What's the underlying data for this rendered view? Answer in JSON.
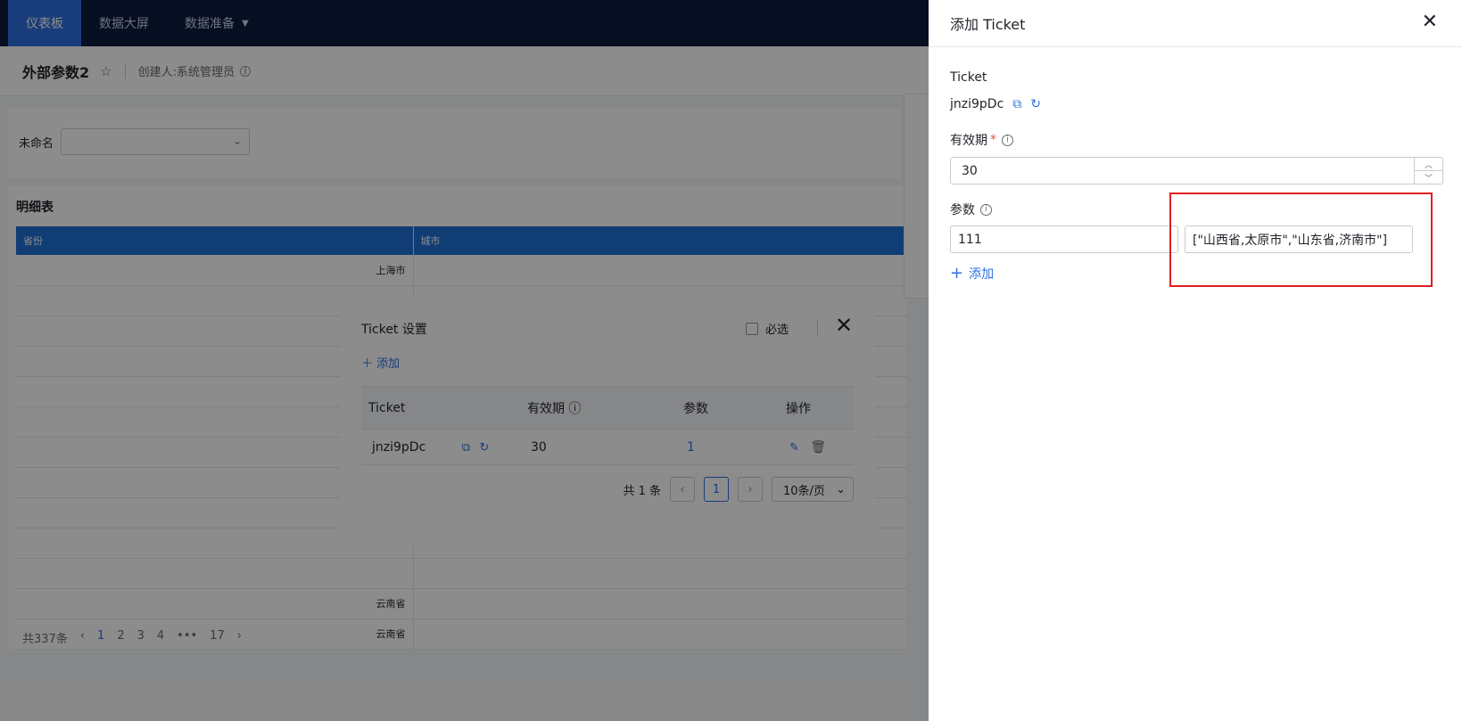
{
  "nav": {
    "items": [
      "仪表板",
      "数据大屏",
      "数据准备"
    ]
  },
  "subheader": {
    "title": "外部参数2",
    "creator": "创建人:系统管理员"
  },
  "filter": {
    "label": "未命名",
    "value": ""
  },
  "detail_table": {
    "title": "明细表",
    "columns": [
      "省份",
      "城市"
    ],
    "rows": [
      "上海市",
      "",
      "",
      "",
      "",
      "",
      "",
      "",
      "",
      "",
      "",
      "云南省",
      "云南省"
    ],
    "total": "共337条",
    "pages": [
      "1",
      "2",
      "3",
      "4",
      "•••",
      "17"
    ]
  },
  "ticket_dialog": {
    "title": "Ticket 设置",
    "required_label": "必选",
    "add_label": "添加",
    "columns": [
      "Ticket",
      "有效期",
      "参数",
      "操作"
    ],
    "rows": [
      {
        "ticket": "jnzi9pDc",
        "validity": "30",
        "params": "1"
      }
    ],
    "total": "共 1 条",
    "current_page": "1",
    "page_size": "10条/页"
  },
  "drawer": {
    "title": "添加 Ticket",
    "ticket_label": "Ticket",
    "ticket_value": "jnzi9pDc",
    "validity_label": "有效期",
    "validity_value": "30",
    "params_label": "参数",
    "param_key": "111",
    "param_value": "[\"山西省,太原市\",\"山东省,济南市\"]",
    "add_label": "添加"
  },
  "colors": {
    "accent": "#2e6fe0",
    "nav_bg": "#0b1a3e",
    "highlight": "#e02020",
    "required": "#f54a45"
  }
}
